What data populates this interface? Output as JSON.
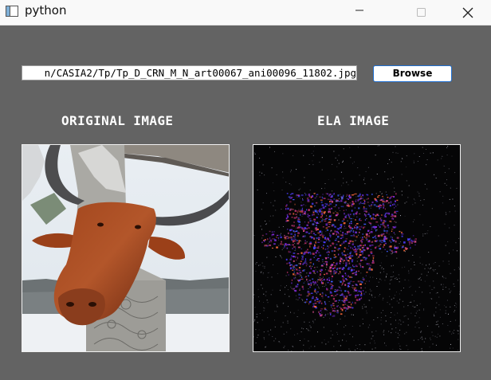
{
  "window": {
    "title": "python",
    "icons": {
      "app": "window-icon",
      "minimize": "minimize-icon",
      "maximize": "maximize-icon",
      "close": "close-icon"
    }
  },
  "form": {
    "file_path": "n/CASIA2/Tp/Tp_D_CRN_M_N_art00067_ani00096_11802.jpg",
    "browse_label": "Browse"
  },
  "panels": {
    "original_title": "ORIGINAL IMAGE",
    "ela_title": "ELA IMAGE"
  },
  "colors": {
    "background": "#636363",
    "accent": "#1f6fd1",
    "heading_text": "#ffffff"
  }
}
